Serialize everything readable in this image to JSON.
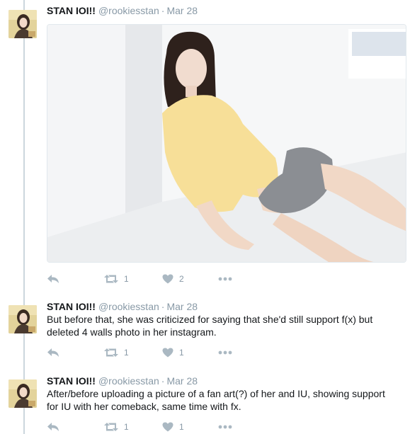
{
  "tweets": [
    {
      "name": "STAN IOI!!",
      "handle": "@rookiesstan",
      "separator": "·",
      "date": "Mar 28",
      "text": "",
      "has_media": true,
      "retweets": "1",
      "likes": "2"
    },
    {
      "name": "STAN IOI!!",
      "handle": "@rookiesstan",
      "separator": "·",
      "date": "Mar 28",
      "text": "But before that, she was criticized for saying that she'd still support f(x) but deleted 4 walls photo in her instagram.",
      "has_media": false,
      "retweets": "1",
      "likes": "1"
    },
    {
      "name": "STAN IOI!!",
      "handle": "@rookiesstan",
      "separator": "·",
      "date": "Mar 28",
      "text": "After/before uploading a picture of a fan art(?) of her and IU, showing support for IU with her comeback, same time with fx.",
      "has_media": false,
      "retweets": "1",
      "likes": "1"
    }
  ],
  "icons": {
    "reply": "reply-icon",
    "retweet": "retweet-icon",
    "like": "heart-icon",
    "more": "more-icon"
  },
  "colors": {
    "action_gray": "#aab8c2",
    "meta_gray": "#8899a6",
    "thread_line": "#ccd6dd"
  }
}
